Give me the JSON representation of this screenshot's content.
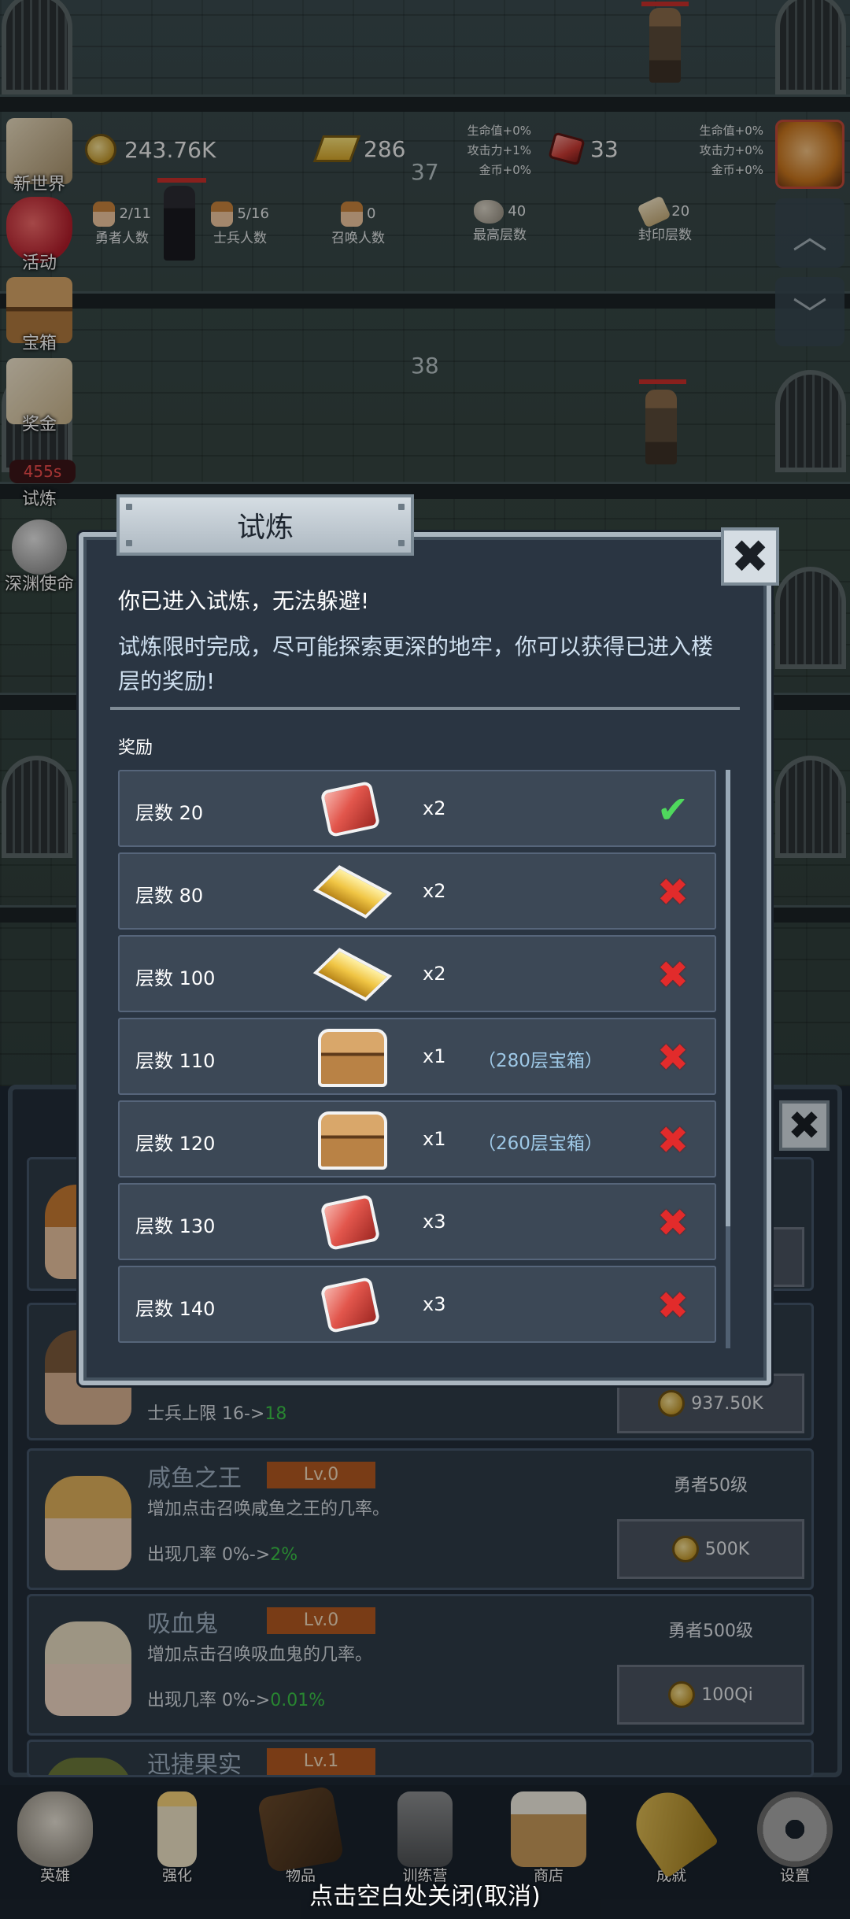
{
  "hud": {
    "coins": "243.76K",
    "gold_bars": "286",
    "rubies": "33",
    "buffs_left": [
      "生命值+0%",
      "攻击力+1%",
      "金币+0%"
    ],
    "buffs_right": [
      "生命值+0%",
      "攻击力+0%",
      "金币+0%"
    ],
    "counters": [
      {
        "value": "2/11",
        "label": "勇者人数"
      },
      {
        "value": "5/16",
        "label": "士兵人数"
      },
      {
        "value": "0",
        "label": "召唤人数"
      },
      {
        "value": "40",
        "label": "最高层数"
      },
      {
        "value": "20",
        "label": "封印层数"
      }
    ],
    "floor_numbers": [
      "37",
      "38"
    ]
  },
  "side_menu": {
    "items": [
      "新世界",
      "活动",
      "宝箱",
      "奖金",
      "试炼",
      "深渊使命"
    ],
    "timer": "455s"
  },
  "dialog": {
    "tab_title": "试炼",
    "close_glyph": "✖",
    "title": "你已进入试炼，无法躲避!",
    "description": "试炼限时完成，尽可能探索更深的地牢，你可以获得已进入楼层的奖励!",
    "rewards_label": "奖励",
    "rewards": [
      {
        "floor": "层数 20",
        "icon": "ruby",
        "qty": "x2",
        "note": "",
        "status": "done"
      },
      {
        "floor": "层数 80",
        "icon": "gold-bar",
        "qty": "x2",
        "note": "",
        "status": "pending"
      },
      {
        "floor": "层数 100",
        "icon": "gold-bar",
        "qty": "x2",
        "note": "",
        "status": "pending"
      },
      {
        "floor": "层数 110",
        "icon": "chest",
        "qty": "x1",
        "note": "（280层宝箱）",
        "status": "pending"
      },
      {
        "floor": "层数 120",
        "icon": "chest",
        "qty": "x1",
        "note": "（260层宝箱）",
        "status": "pending"
      },
      {
        "floor": "层数 130",
        "icon": "ruby",
        "qty": "x3",
        "note": "",
        "status": "pending"
      },
      {
        "floor": "层数 140",
        "icon": "ruby",
        "qty": "x3",
        "note": "",
        "status": "pending"
      }
    ],
    "status_glyphs": {
      "done": "✔",
      "pending": "✖"
    }
  },
  "upgrades": {
    "close_glyph": "✖",
    "soldier_row": {
      "effect_prefix": "士兵上限 16->",
      "effect_value": "18",
      "price": "937.50K"
    },
    "rows": [
      {
        "name": "咸鱼之王",
        "level": "Lv.0",
        "desc": "增加点击召唤咸鱼之王的几率。",
        "effect_prefix": "出现几率 0%->",
        "effect_value": "2%",
        "requirement": "勇者50级",
        "price": "500K"
      },
      {
        "name": "吸血鬼",
        "level": "Lv.0",
        "desc": "增加点击召唤吸血鬼的几率。",
        "effect_prefix": "出现几率 0%->",
        "effect_value": "0.01%",
        "requirement": "勇者500级",
        "price": "100Qi"
      },
      {
        "name": "迅捷果实",
        "level": "Lv.1"
      }
    ]
  },
  "bottom_nav": {
    "items": [
      "英雄",
      "强化",
      "物品",
      "训练营",
      "商店",
      "成就",
      "设置"
    ],
    "close_hint": "点击空白处关闭(取消)"
  },
  "colors": {
    "accent_orange": "#b35921",
    "green_value": "#3bc548",
    "done_check": "#4fd85d",
    "pending_cross": "#e22b2b"
  }
}
